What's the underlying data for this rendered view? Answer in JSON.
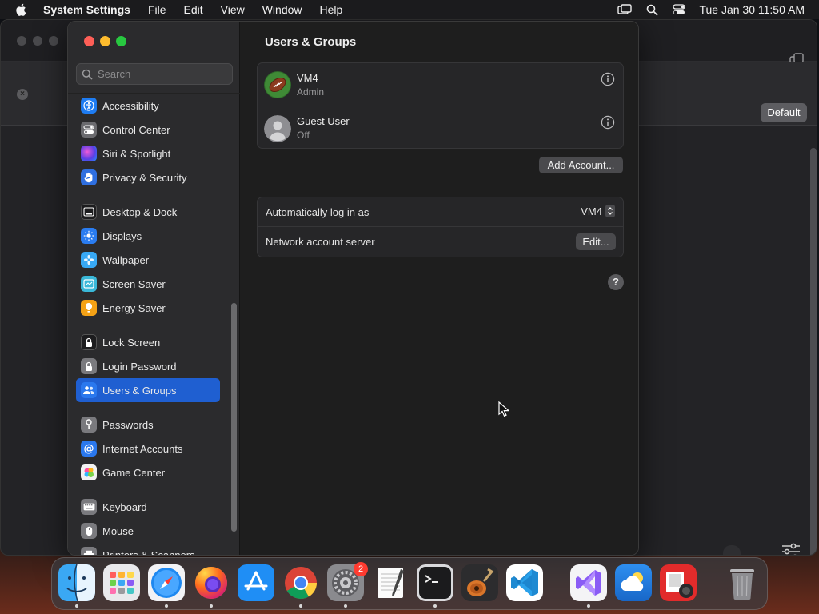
{
  "menubar": {
    "app_name": "System Settings",
    "items": [
      "File",
      "Edit",
      "View",
      "Window",
      "Help"
    ],
    "clock": "Tue Jan 30  11:50 AM"
  },
  "background_window": {
    "default_button": "Default"
  },
  "sidebar": {
    "search_placeholder": "Search",
    "items": [
      {
        "label": "Accessibility",
        "icon": "accessibility-icon",
        "color": "#1e7cf2"
      },
      {
        "label": "Control Center",
        "icon": "control-center-icon",
        "color": "#6b6b6f"
      },
      {
        "label": "Siri & Spotlight",
        "icon": "siri-icon",
        "color": "#7b3fe4"
      },
      {
        "label": "Privacy & Security",
        "icon": "hand-icon",
        "color": "#2f6fe0"
      },
      {
        "label": "Desktop & Dock",
        "icon": "dock-icon",
        "color": "#1c1c1e"
      },
      {
        "label": "Displays",
        "icon": "sun-icon",
        "color": "#2a7cf0"
      },
      {
        "label": "Wallpaper",
        "icon": "flower-icon",
        "color": "#38a9f5"
      },
      {
        "label": "Screen Saver",
        "icon": "screen-saver-icon",
        "color": "#3ab8d8"
      },
      {
        "label": "Energy Saver",
        "icon": "bulb-icon",
        "color": "#f4a216"
      },
      {
        "label": "Lock Screen",
        "icon": "lock-icon",
        "color": "#1c1c1e"
      },
      {
        "label": "Login Password",
        "icon": "login-lock-icon",
        "color": "#7a7a7e"
      },
      {
        "label": "Users & Groups",
        "icon": "users-icon",
        "color": "#2a78ee"
      },
      {
        "label": "Passwords",
        "icon": "key-icon",
        "color": "#7a7a7e"
      },
      {
        "label": "Internet Accounts",
        "icon": "at-icon",
        "color": "#2a78ee"
      },
      {
        "label": "Game Center",
        "icon": "game-center-icon",
        "color": "#e8e8e8"
      },
      {
        "label": "Keyboard",
        "icon": "keyboard-icon",
        "color": "#7a7a7e"
      },
      {
        "label": "Mouse",
        "icon": "mouse-icon",
        "color": "#7a7a7e"
      },
      {
        "label": "Printers & Scanners",
        "icon": "printer-icon",
        "color": "#7a7a7e"
      }
    ],
    "selected": "Users & Groups"
  },
  "main": {
    "title": "Users & Groups",
    "users": [
      {
        "name": "VM4",
        "role": "Admin",
        "avatar": "football-avatar"
      },
      {
        "name": "Guest User",
        "role": "Off",
        "avatar": "guest-avatar"
      }
    ],
    "add_account_label": "Add Account...",
    "settings": [
      {
        "label": "Automatically log in as",
        "value": "VM4"
      },
      {
        "label": "Network account server",
        "button": "Edit..."
      }
    ],
    "help_label": "?"
  },
  "dock": {
    "apps": [
      {
        "name": "Finder",
        "icon": "finder-icon",
        "running": true
      },
      {
        "name": "Launchpad",
        "icon": "launchpad-icon",
        "running": false
      },
      {
        "name": "Safari",
        "icon": "safari-icon",
        "running": true
      },
      {
        "name": "Firefox",
        "icon": "firefox-icon",
        "running": true
      },
      {
        "name": "App Store",
        "icon": "app-store-icon",
        "running": false
      },
      {
        "name": "Chrome",
        "icon": "chrome-icon",
        "running": true
      },
      {
        "name": "System Settings",
        "icon": "system-settings-icon",
        "running": true,
        "badge": "2"
      },
      {
        "name": "TextEdit",
        "icon": "textedit-icon",
        "running": false
      },
      {
        "name": "Terminal",
        "icon": "terminal-icon",
        "running": true
      },
      {
        "name": "GarageBand",
        "icon": "garageband-icon",
        "running": false
      },
      {
        "name": "VS Code",
        "icon": "vscode-icon",
        "running": false
      },
      {
        "name": "Visual Studio",
        "icon": "visual-studio-icon",
        "running": true
      },
      {
        "name": "Weather",
        "icon": "weather-icon",
        "running": false
      },
      {
        "name": "Photo Booth",
        "icon": "photo-booth-icon",
        "running": false
      },
      {
        "name": "Trash",
        "icon": "trash-icon",
        "running": false
      }
    ]
  }
}
